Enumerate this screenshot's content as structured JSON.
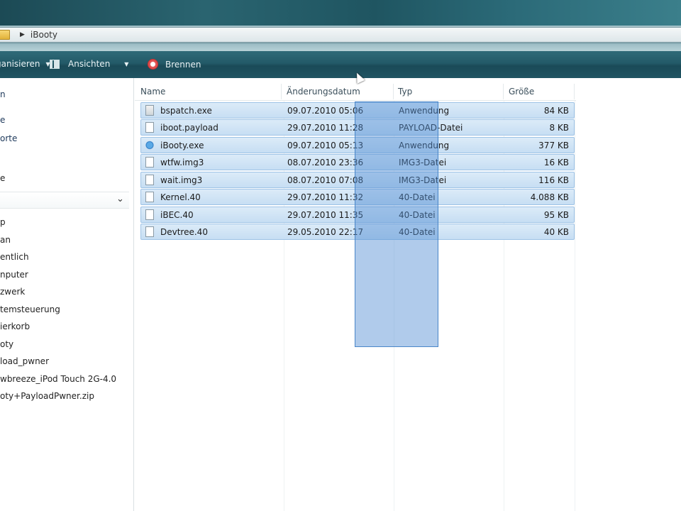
{
  "address": {
    "crumb": "iBooty"
  },
  "commandbar": {
    "organize_label": "ganisieren",
    "views_label": "Ansichten",
    "burn_label": "Brennen"
  },
  "sidebar": {
    "items": [
      "n",
      "e",
      "orte",
      "e",
      "p",
      "an",
      "entlich",
      "nputer",
      "zwerk",
      "temsteuerung",
      "ierkorb",
      "oty",
      "load_pwner",
      "wbreeze_iPod Touch 2G-4.0",
      "oty+PayloadPwner.zip"
    ]
  },
  "columns": {
    "name": "Name",
    "date": "Änderungsdatum",
    "type": "Typ",
    "size": "Größe"
  },
  "files": [
    {
      "name": "bspatch.exe",
      "date": "09.07.2010 05:06",
      "type": "Anwendung",
      "size": "84 KB",
      "icon": "exe-icon"
    },
    {
      "name": "iboot.payload",
      "date": "29.07.2010 11:28",
      "type": "PAYLOAD-Datei",
      "size": "8 KB",
      "icon": "file-icon"
    },
    {
      "name": "iBooty.exe",
      "date": "09.07.2010 05:13",
      "type": "Anwendung",
      "size": "377 KB",
      "icon": "app-icon"
    },
    {
      "name": "wtfw.img3",
      "date": "08.07.2010 23:36",
      "type": "IMG3-Datei",
      "size": "16 KB",
      "icon": "file-icon"
    },
    {
      "name": "wait.img3",
      "date": "08.07.2010 07:08",
      "type": "IMG3-Datei",
      "size": "116 KB",
      "icon": "file-icon"
    },
    {
      "name": "Kernel.40",
      "date": "29.07.2010 11:32",
      "type": "40-Datei",
      "size": "4.088 KB",
      "icon": "file-icon"
    },
    {
      "name": "iBEC.40",
      "date": "29.07.2010 11:35",
      "type": "40-Datei",
      "size": "95 KB",
      "icon": "file-icon"
    },
    {
      "name": "Devtree.40",
      "date": "29.05.2010 22:17",
      "type": "40-Datei",
      "size": "40 KB",
      "icon": "file-icon"
    }
  ]
}
